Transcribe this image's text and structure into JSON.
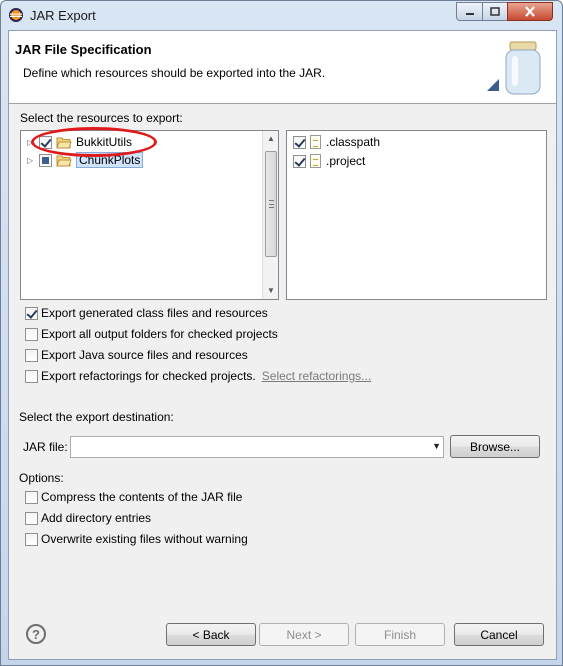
{
  "window": {
    "title": "JAR Export"
  },
  "banner": {
    "title": "JAR File Specification",
    "description": "Define which resources should be exported into the JAR."
  },
  "resources": {
    "label": "Select the resources to export:",
    "projects": [
      {
        "name": "BukkitUtils",
        "checked": true,
        "partial": false,
        "selected": false
      },
      {
        "name": "ChunkPlots",
        "checked": false,
        "partial": true,
        "selected": true
      }
    ],
    "files": [
      {
        "name": ".classpath",
        "checked": true
      },
      {
        "name": ".project",
        "checked": true
      }
    ]
  },
  "export_options": [
    {
      "label": "Export generated class files and resources",
      "checked": true
    },
    {
      "label": "Export all output folders for checked projects",
      "checked": false
    },
    {
      "label": "Export Java source files and resources",
      "checked": false
    },
    {
      "label": "Export refactorings for checked projects.",
      "checked": false,
      "link": "Select refactorings..."
    }
  ],
  "destination": {
    "label": "Select the export destination:",
    "jar_label": "JAR file:",
    "jar_value": "",
    "browse_label": "Browse..."
  },
  "options": {
    "label": "Options:",
    "items": [
      {
        "label": "Compress the contents of the JAR file",
        "checked": false
      },
      {
        "label": "Add directory entries",
        "checked": false
      },
      {
        "label": "Overwrite existing files without warning",
        "checked": false
      }
    ]
  },
  "footer": {
    "back_label": "< Back",
    "next_label": "Next >",
    "finish_label": "Finish",
    "cancel_label": "Cancel"
  },
  "colors": {
    "selection": "#cfe3fa",
    "annotation": "#e01b1b",
    "disabled_text": "#8e8e8e"
  }
}
